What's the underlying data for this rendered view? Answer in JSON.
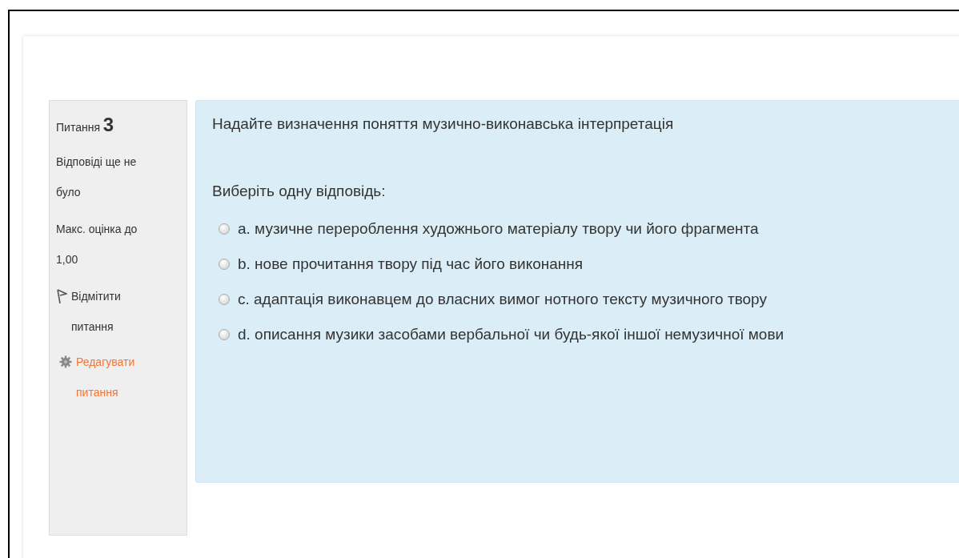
{
  "info": {
    "label": "Питання",
    "number": "3",
    "state": "Відповіді ще не було",
    "grade": "Макс. оцінка до 1,00",
    "flag_link": "Відмітити питання",
    "edit_link": "Редагувати питання"
  },
  "question": {
    "text": "Надайте визначення поняття музично-виконавська інтерпретація",
    "prompt": "Виберіть одну відповідь:",
    "options": [
      {
        "text": "a. музичне перероблення художнього матеріалу твору чи його фрагмента",
        "selected": false
      },
      {
        "text": "b. нове прочитання твору під час його виконання",
        "selected": false
      },
      {
        "text": "c. адаптація виконавцем до власних вимог нотного тексту музичного твору",
        "selected": false
      },
      {
        "text": "d. описання музики засобами вербальної чи будь-якої іншої немузичної мови",
        "selected": false
      }
    ]
  }
}
